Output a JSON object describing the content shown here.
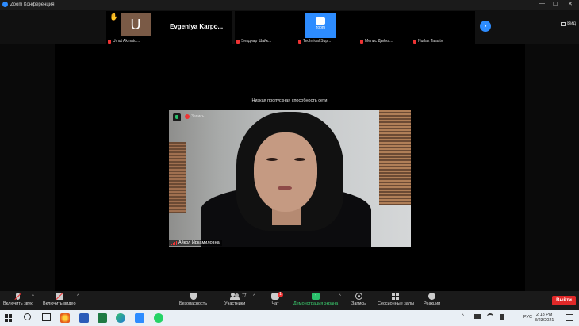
{
  "window": {
    "title": "Zoom Конференция",
    "controls": [
      "—",
      "☐",
      "✕"
    ]
  },
  "strip": {
    "view_label": "Вид",
    "tiles": [
      {
        "name": "Umut Akmato...",
        "initial": "U",
        "hand": "✋",
        "kind": "initial"
      },
      {
        "name": "Evgeniya  Karpo...",
        "kind": "name-only"
      },
      {
        "name": "Эльдиар Шайк...",
        "kind": "dark"
      },
      {
        "name": "Technical Sup...",
        "logo_text": "zoom",
        "kind": "zoom"
      },
      {
        "name": "Мелис Дыйка...",
        "kind": "dark"
      },
      {
        "name": "Nurlaz Talastv",
        "kind": "dark"
      }
    ]
  },
  "stage": {
    "warning": "Низкая пропускная способность сети",
    "rec_text": "Запись",
    "speaker_name": "Айкол Иркамиловна"
  },
  "toolbar": {
    "items": [
      {
        "label": "Включить звук",
        "icon": "mic-muted-icon"
      },
      {
        "label": "Включить видео",
        "icon": "video-off-icon"
      },
      {
        "label": "Безопасность",
        "icon": "shield-icon"
      },
      {
        "label": "Участники",
        "icon": "participants-icon",
        "count": "77"
      },
      {
        "label": "Чат",
        "icon": "chat-icon",
        "badge": "1"
      },
      {
        "label": "Демонстрация экрана",
        "icon": "share-screen-icon"
      },
      {
        "label": "Запись",
        "icon": "record-icon"
      },
      {
        "label": "Сессионные залы",
        "icon": "breakout-rooms-icon"
      },
      {
        "label": "Реакции",
        "icon": "reactions-icon"
      }
    ],
    "leave_label": "Выйти"
  },
  "taskbar": {
    "lang": "РУС",
    "time": "2:18 PM",
    "date": "3/23/2021",
    "accent": "#2d8cff"
  }
}
